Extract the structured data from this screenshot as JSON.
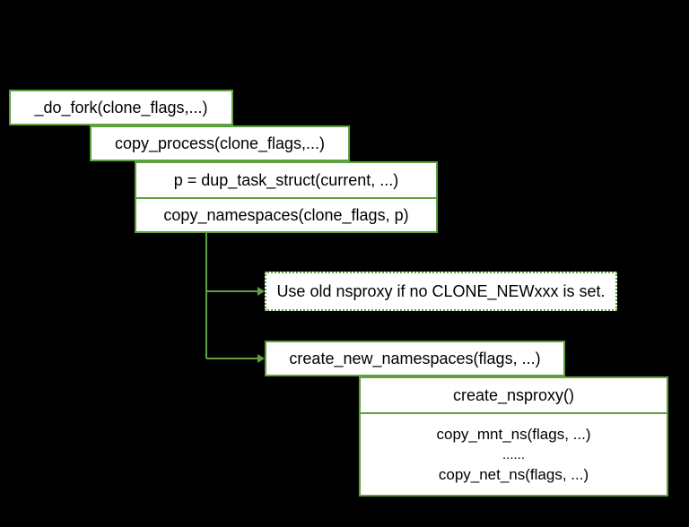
{
  "boxes": {
    "do_fork": "_do_fork(clone_flags,...)",
    "copy_process": "copy_process(clone_flags,...)",
    "dup_task": "p = dup_task_struct(current, ...)",
    "copy_namespaces": "copy_namespaces(clone_flags, p)",
    "old_nsproxy": "Use old nsproxy if no CLONE_NEWxxx is set.",
    "create_new_ns": "create_new_namespaces(flags, ...)",
    "create_nsproxy": "create_nsproxy()",
    "copy_mnt_ns": "copy_mnt_ns(flags, ...)",
    "ellipsis": "......",
    "copy_net_ns": "copy_net_ns(flags, ...)"
  }
}
